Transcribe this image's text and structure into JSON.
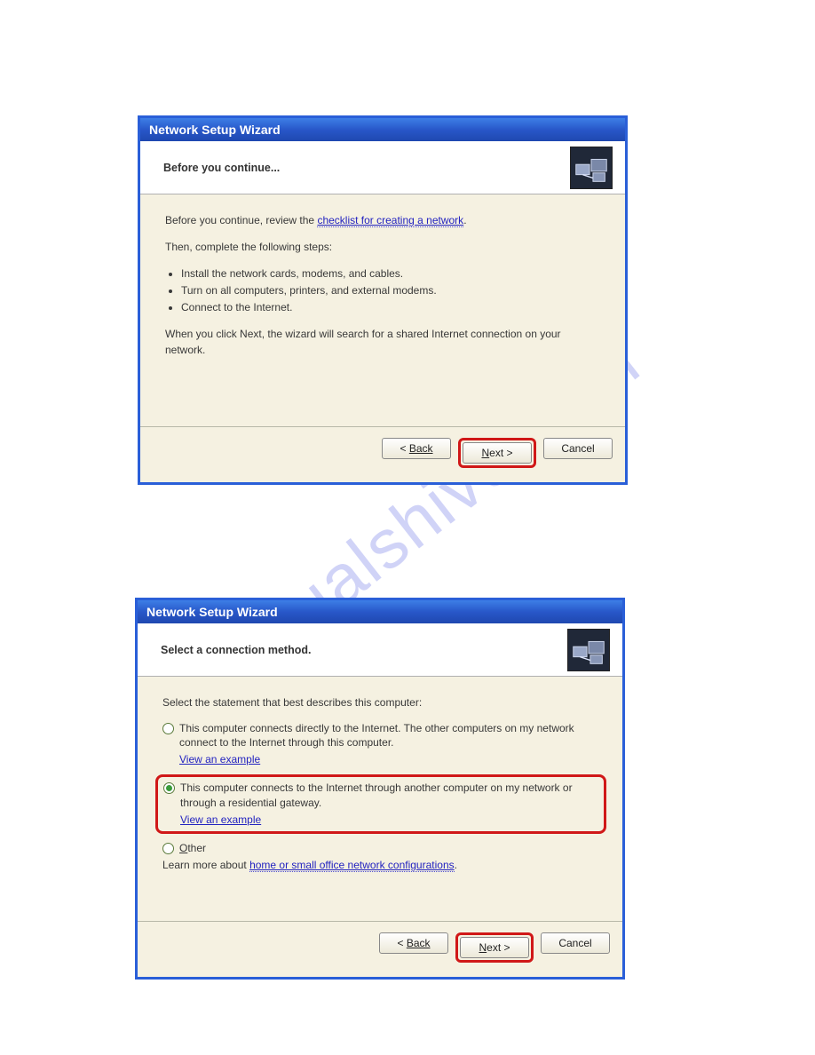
{
  "watermark": "manualshive.com",
  "dialog1": {
    "title": "Network Setup Wizard",
    "header": "Before you continue...",
    "intro_prefix": "Before you continue, review the ",
    "intro_link": "checklist for creating a network",
    "intro_suffix": ".",
    "then": "Then, complete the following steps:",
    "bullets": [
      "Install the network cards, modems, and cables.",
      "Turn on all computers, printers, and external modems.",
      "Connect to the Internet."
    ],
    "note": "When you click Next, the wizard will search for a shared Internet connection on your network.",
    "buttons": {
      "back": "Back",
      "next": "Next >",
      "cancel": "Cancel"
    }
  },
  "dialog2": {
    "title": "Network Setup Wizard",
    "header": "Select a connection method.",
    "prompt": "Select the statement that best describes this computer:",
    "opt1": "This computer connects directly to the Internet. The other computers on my network connect to the Internet through this computer.",
    "opt1_link": "View an example",
    "opt2": "This computer connects to the Internet through another computer on my network or through a residential gateway.",
    "opt2_link": "View an example",
    "opt3": "Other",
    "learn_prefix": "Learn more about ",
    "learn_link": "home or small office network configurations",
    "learn_suffix": ".",
    "buttons": {
      "back": "Back",
      "next": "Next >",
      "cancel": "Cancel"
    }
  }
}
